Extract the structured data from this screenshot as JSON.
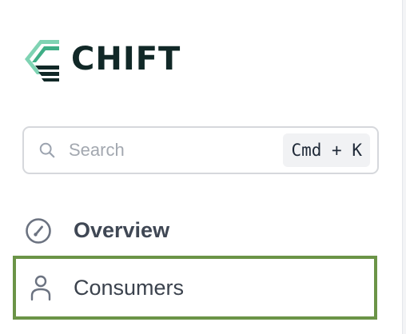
{
  "brand": {
    "name": "CHIFT",
    "logo_icon": "chift-logo-icon",
    "colors": {
      "mark_light": "#7fd3b3",
      "mark_mid": "#3fae86",
      "mark_dark": "#112827",
      "text": "#112827"
    }
  },
  "search": {
    "icon": "search-icon",
    "placeholder": "Search",
    "value": "",
    "shortcut": "Cmd + K"
  },
  "nav": {
    "items": [
      {
        "label": "Overview",
        "icon": "gauge-icon",
        "active": true
      },
      {
        "label": "Consumers",
        "icon": "user-icon",
        "highlighted": true
      }
    ]
  },
  "colors": {
    "highlight_border": "#6b9447",
    "text": "#374151",
    "placeholder": "#a3a8b0",
    "border": "#d6d8dc"
  }
}
